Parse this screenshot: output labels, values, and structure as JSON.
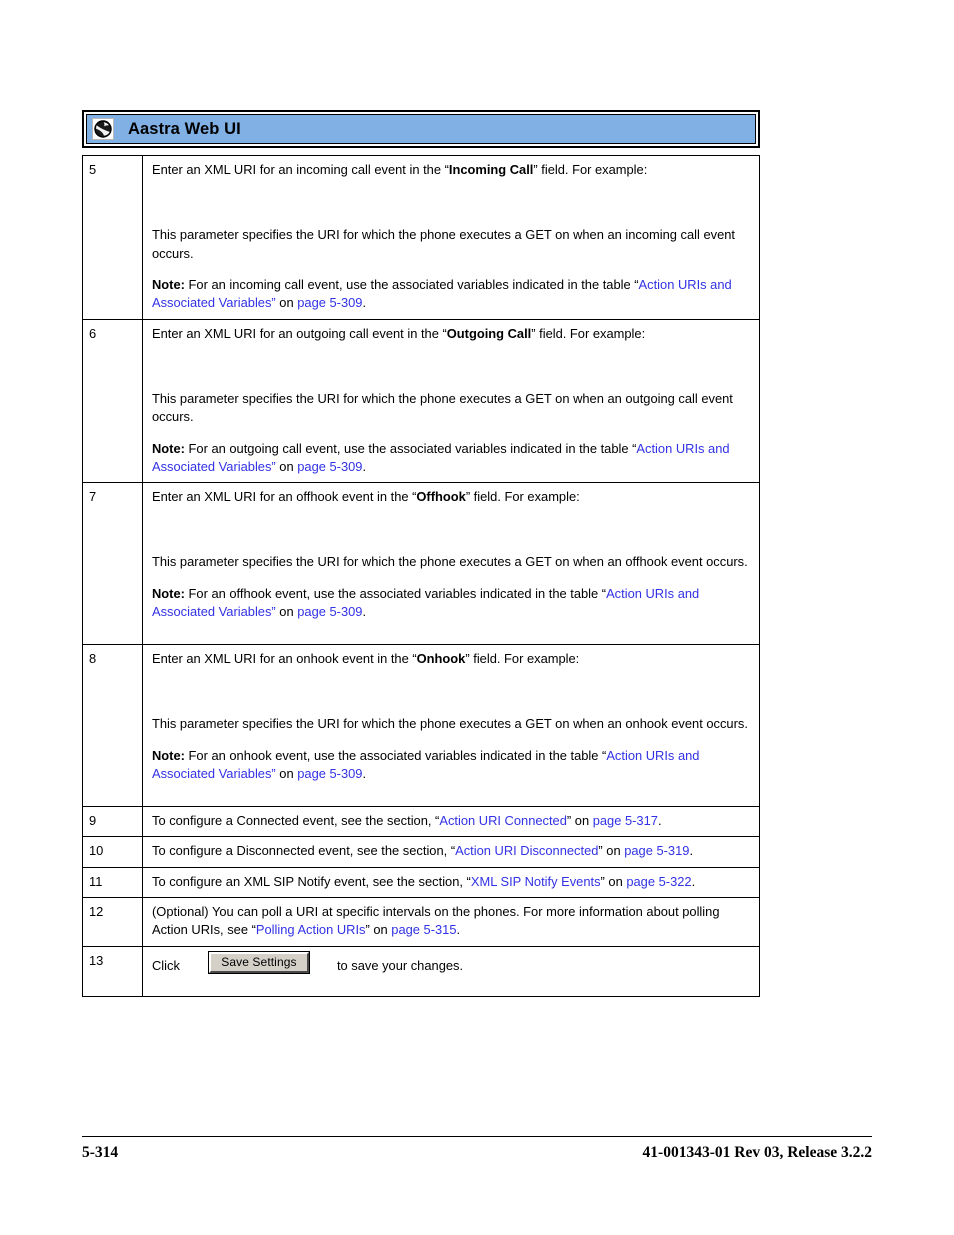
{
  "header": {
    "logo_icon": "aastra-globe-icon",
    "title": "Aastra Web UI",
    "bar_color": "#80b0e4"
  },
  "link_color": "#3232e6",
  "steps": [
    {
      "number": "5",
      "intro_prefix": "Enter an XML URI for an incoming call event in the “",
      "intro_bold": "Incoming Call",
      "intro_suffix": "” field. For example:",
      "desc": "This parameter specifies the URI for which the phone executes a GET on when an incoming call event occurs.",
      "note_label": "Note:",
      "note_text": " For an incoming call event, use the associated variables indicated in the table ",
      "note_quote_open": "“",
      "note_link": "Action URIs and Associated Variables",
      "note_quote_close": "”",
      "note_on": " on ",
      "note_page_link": "page 5-309",
      "note_period": "."
    },
    {
      "number": "6",
      "intro_prefix": "Enter an XML URI for an outgoing call event in the “",
      "intro_bold": "Outgoing Call",
      "intro_suffix": "” field. For example:",
      "desc": "This parameter specifies the URI for which the phone executes a GET on when an outgoing call event occurs.",
      "note_label": "Note:",
      "note_text": " For an outgoing call event, use the associated variables indicated in the table ",
      "note_quote_open": "“",
      "note_link": "Action URIs and Associated Variables",
      "note_quote_close": "”",
      "note_on": " on ",
      "note_page_link": "page 5-309",
      "note_period": "."
    },
    {
      "number": "7",
      "intro_prefix": "Enter an XML URI for an offhook event in the “",
      "intro_bold": "Offhook",
      "intro_suffix": "” field. For example:",
      "desc": "This parameter specifies the URI for which the phone executes a GET on when an offhook event occurs.",
      "note_label": "Note:",
      "note_text": " For an offhook event, use the associated variables indicated in the table ",
      "note_quote_open": "“",
      "note_link": "Action URIs and Associated Variables",
      "note_quote_close": "”",
      "note_on": " on ",
      "note_page_link": "page 5-309",
      "note_period": "."
    },
    {
      "number": "8",
      "intro_prefix": "Enter an XML URI for an onhook event in the “",
      "intro_bold": "Onhook",
      "intro_suffix": "” field. For example:",
      "desc": "This parameter specifies the URI for which the phone executes a GET on when an onhook event occurs.",
      "note_label": "Note:",
      "note_text": " For an onhook event, use the associated variables indicated in the table ",
      "note_quote_open": "“",
      "note_link": "Action URIs and Associated Variables",
      "note_quote_close": "”",
      "note_on": " on ",
      "note_page_link": "page 5-309",
      "note_period": "."
    }
  ],
  "short_steps": [
    {
      "number": "9",
      "prefix": "To configure a Connected event, see the section, “",
      "link": "Action URI Connected",
      "mid": "” on ",
      "page_link": "page 5-317",
      "suffix": "."
    },
    {
      "number": "10",
      "prefix": "To configure a Disconnected event, see the section, “",
      "link": "Action URI Disconnected",
      "mid": "” on ",
      "page_link": "page 5-319",
      "suffix": "."
    },
    {
      "number": "11",
      "prefix": "To configure an XML SIP Notify event, see the section, “",
      "link": "XML SIP Notify Events",
      "mid": "” on ",
      "page_link": "page 5-322",
      "suffix": "."
    }
  ],
  "optional_step": {
    "number": "12",
    "prefix": "(Optional) You can poll a URI at specific intervals on the phones. For more information about polling Action URIs, see “",
    "link": "Polling Action URIs",
    "mid": "” on ",
    "page_link": "page 5-315",
    "suffix": "."
  },
  "save_step": {
    "number": "13",
    "click_label": "Click",
    "button_label": "Save Settings",
    "tail_label": "to save your changes."
  },
  "footer": {
    "page_number": "5-314",
    "doc_ref": "41-001343-01 Rev 03, Release 3.2.2"
  }
}
